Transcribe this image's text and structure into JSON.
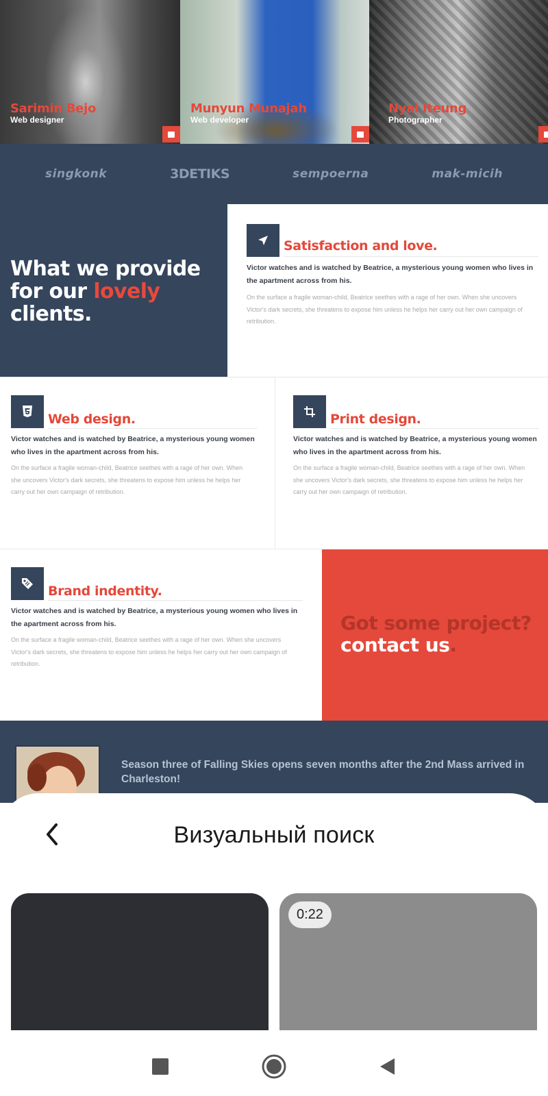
{
  "team": [
    {
      "name": "Sarimin Bejo",
      "role": "Web designer"
    },
    {
      "name": "Munyun Munajah",
      "role": "Web developer"
    },
    {
      "name": "Nyai Iteung",
      "role": "Photographer"
    }
  ],
  "logos": [
    "singkonk",
    "3DETIKS",
    "sempoerna",
    "mak-micih"
  ],
  "provide": {
    "line1": "What we provide",
    "line2_a": "for our ",
    "line2_highlight": "lovely",
    "line3": "clients."
  },
  "services": {
    "satisfaction": {
      "title": "Satisfaction and love.",
      "lead": "Victor watches and is watched by Beatrice, a mysterious young women who lives in the apartment across from his.",
      "body": "On the surface a fragile woman-child, Beatrice seethes with a rage of her own. When she uncovers Victor's dark secrets, she threatens to expose him unless he helps her carry out her own campaign of retribution."
    },
    "web": {
      "title": "Web design.",
      "lead": "Victor watches and is watched by Beatrice, a mysterious young women who lives in the apartment across from his.",
      "body": "On the surface a fragile woman-child, Beatrice seethes with a rage of her own. When she uncovers Victor's dark secrets, she threatens to expose him unless he helps her carry out her own campaign of retribution."
    },
    "print": {
      "title": "Print design.",
      "lead": "Victor watches and is watched by Beatrice, a mysterious young women who lives in the apartment across from his.",
      "body": "On the surface a fragile woman-child, Beatrice seethes with a rage of her own. When she uncovers Victor's dark secrets, she threatens to expose him unless he helps her carry out her own campaign of retribution."
    },
    "brand": {
      "title": "Brand indentity.",
      "lead": "Victor watches and is watched by Beatrice, a mysterious young women who lives in the apartment across from his.",
      "body": "On the surface a fragile woman-child, Beatrice seethes with a rage of her own. When she uncovers Victor's dark secrets, she threatens to expose him unless he helps her carry out her own campaign of retribution."
    }
  },
  "cta": {
    "question": "Got some project?",
    "contact": "contact us",
    "dot": "."
  },
  "testimonial": {
    "quote": "Season three of Falling Skies opens seven months after the 2nd Mass arrived in Charleston!"
  },
  "sheet": {
    "title": "Визуальный поиск",
    "video_duration": "0:22"
  },
  "colors": {
    "navy": "#34455c",
    "accent": "#e4493b"
  },
  "icons": [
    "back-chevron-icon",
    "navigation-arrow-icon",
    "html5-icon",
    "crop-icon",
    "tag-icon",
    "recents-square-icon",
    "home-circle-icon",
    "back-triangle-icon"
  ]
}
